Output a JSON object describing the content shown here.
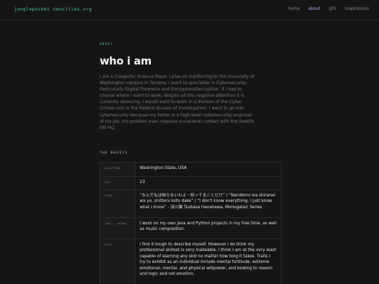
{
  "header": {
    "site_title": "junglepocket.neocities.org",
    "nav": [
      "home",
      "about",
      "gifs",
      "inspirations"
    ],
    "active_nav": "about",
    "accent_color": "#58c894",
    "active_color": "#b6a9f0"
  },
  "page": {
    "eyebrow": "ABOUT",
    "title": "who i am",
    "intro": "I am a Computer Science Major. I plan on tranferring to the University of Washington campus in Tacoma. I want to specialize in Cybersecurity. Particularly Digital Forensics and Encryption/Decryption. If I had to choose where I want to work, despite all the negative attention it is currently recieving, I would want to work in a division of the Cyber Crimes unit in the Federal Bureau of Investigation. I want to go into cybersecurity because my father is a high-level cybersecurity engineer at his job. His position even requires occasional contact with the Seattle FBI HQ."
  },
  "basics": {
    "label": "THE BASICS",
    "rows": [
      {
        "key": "LOCATION",
        "value": "Washington State, USA"
      },
      {
        "key": "AGE",
        "value": "23"
      },
      {
        "key": "SIGN",
        "value": "“なんでもは知らないわよ・知ってることだけ” / “Nandemo wa shiranai wa yo, shitteru koto dake” / “I don't know everything, I just know what I know” - 羽川翼 Tsubasa Hanekawa, Monogatari Series"
      },
      {
        "key": "JOB / THING",
        "value": "I work on my own Java and Python projects in my free time, as well as music composition."
      },
      {
        "key": "SELF",
        "value": "I find it tough to describe myself. However I do think my professional skillset is very malleable. I think I am at the very least capable of learning any skill no matter how long it takes. Traits I try to exhibit as an individual include mental fortitude, extreme emotional, mental, and physical willpower, and bowing to reason and logic and not emotion."
      }
    ]
  }
}
